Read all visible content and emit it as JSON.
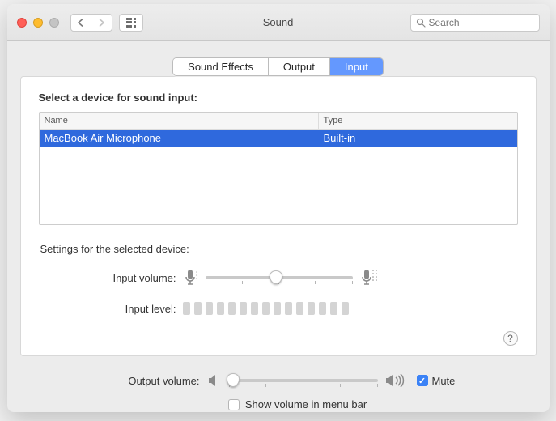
{
  "window": {
    "title": "Sound"
  },
  "search": {
    "placeholder": "Search"
  },
  "tabs": {
    "effects": "Sound Effects",
    "output": "Output",
    "input": "Input"
  },
  "panel": {
    "select_label": "Select a device for sound input:",
    "columns": {
      "name": "Name",
      "type": "Type"
    },
    "rows": [
      {
        "name": "MacBook Air Microphone",
        "type": "Built-in"
      }
    ],
    "settings_label": "Settings for the selected device:",
    "input_volume_label": "Input volume:",
    "input_level_label": "Input level:"
  },
  "output": {
    "volume_label": "Output volume:",
    "mute_label": "Mute",
    "show_volume_label": "Show volume in menu bar",
    "mute_checked": true,
    "show_checked": false,
    "slider_percent": 3,
    "input_slider_percent": 48
  },
  "colors": {
    "accent": "#2f69dd"
  }
}
